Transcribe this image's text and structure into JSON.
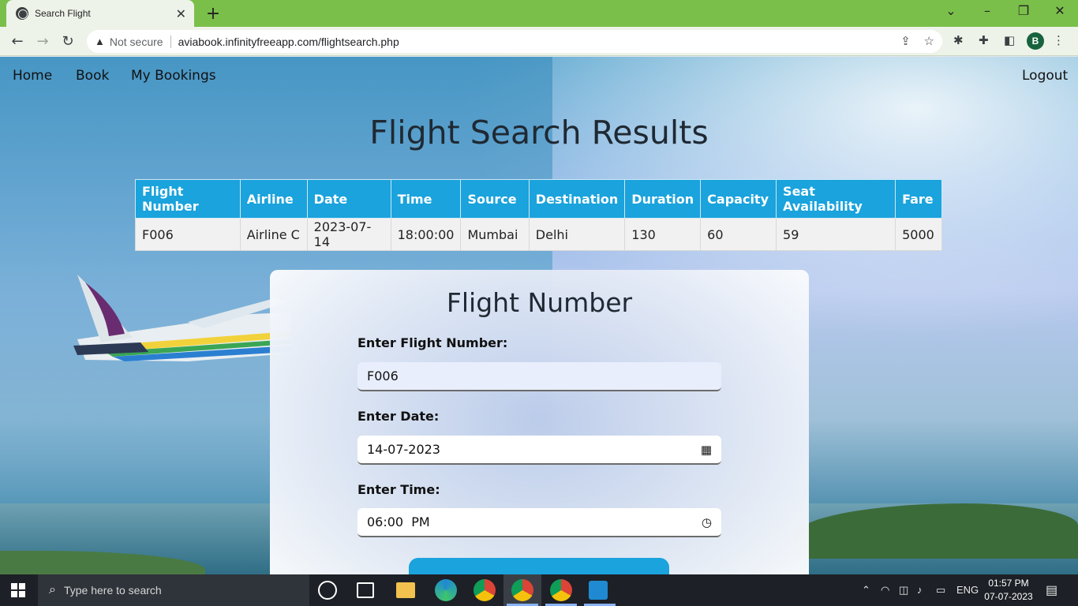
{
  "browser": {
    "tab_title": "Search Flight",
    "not_secure": "Not secure",
    "url": "aviabook.infinityfreeapp.com/flightsearch.php",
    "profile_initial": "B"
  },
  "nav": {
    "home": "Home",
    "book": "Book",
    "my_bookings": "My Bookings",
    "logout": "Logout"
  },
  "page_title": "Flight Search Results",
  "table": {
    "headers": [
      "Flight Number",
      "Airline",
      "Date",
      "Time",
      "Source",
      "Destination",
      "Duration",
      "Capacity",
      "Seat Availability",
      "Fare"
    ],
    "rows": [
      [
        "F006",
        "Airline C",
        "2023-07-14",
        "18:00:00",
        "Mumbai",
        "Delhi",
        "130",
        "60",
        "59",
        "5000"
      ]
    ]
  },
  "form": {
    "heading": "Flight Number",
    "flight_label": "Enter Flight Number:",
    "flight_value": "F006",
    "date_label": "Enter Date:",
    "date_value": "14-07-2023",
    "time_label": "Enter Time:",
    "time_value": "06:00  PM"
  },
  "taskbar": {
    "search_placeholder": "Type here to search",
    "language": "ENG",
    "time": "01:57 PM",
    "date": "07-07-2023"
  },
  "colors": {
    "accent": "#1aa3dc",
    "tabbar": "#7bbf4b"
  }
}
